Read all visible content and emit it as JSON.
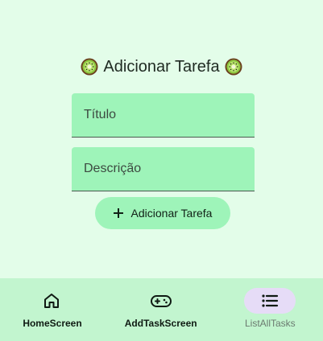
{
  "screen": {
    "title": "Adicionar Tarefa",
    "title_icon": "kiwi-icon"
  },
  "form": {
    "title_placeholder": "Título",
    "title_value": "",
    "description_placeholder": "Descrição",
    "description_value": "",
    "submit_label": "Adicionar Tarefa",
    "submit_icon": "plus-icon"
  },
  "bottom_nav": {
    "items": [
      {
        "label": "HomeScreen",
        "icon": "home-icon",
        "active": false
      },
      {
        "label": "AddTaskScreen",
        "icon": "gamepad-icon",
        "active": false
      },
      {
        "label": "ListAllTasks",
        "icon": "list-icon",
        "active": true
      }
    ]
  },
  "colors": {
    "background": "#e3fde9",
    "field": "#9ef4b9",
    "nav_background": "#c2f5cf",
    "active_indicator": "#e6dcf7"
  }
}
